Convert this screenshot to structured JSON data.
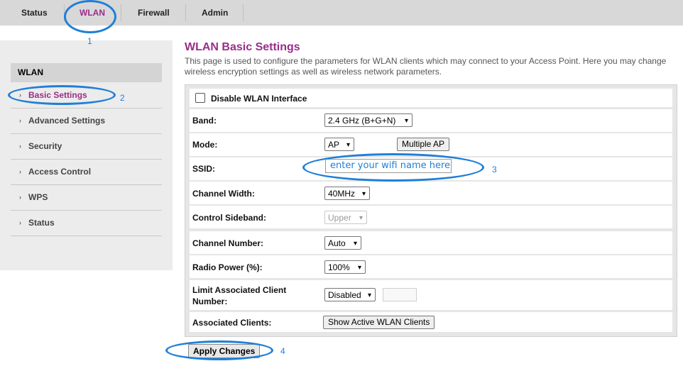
{
  "topnav": {
    "tabs": [
      {
        "label": "Status"
      },
      {
        "label": "WLAN"
      },
      {
        "label": "Firewall"
      },
      {
        "label": "Admin"
      }
    ]
  },
  "sidebar": {
    "heading": "WLAN",
    "items": [
      {
        "label": "Basic Settings"
      },
      {
        "label": "Advanced Settings"
      },
      {
        "label": "Security"
      },
      {
        "label": "Access Control"
      },
      {
        "label": "WPS"
      },
      {
        "label": "Status"
      }
    ]
  },
  "page": {
    "title": "WLAN Basic Settings",
    "description": "This page is used to configure the parameters for WLAN clients which may connect to your Access Point. Here you may change wireless encryption settings as well as wireless network parameters."
  },
  "form": {
    "disable_label": "Disable WLAN Interface",
    "band_label": "Band:",
    "band_value": "2.4 GHz (B+G+N)",
    "mode_label": "Mode:",
    "mode_value": "AP",
    "multiple_ap_label": "Multiple AP",
    "ssid_label": "SSID:",
    "ssid_value": "enter your wifi name here",
    "channel_width_label": "Channel Width:",
    "channel_width_value": "40MHz",
    "control_sideband_label": "Control Sideband:",
    "control_sideband_value": "Upper",
    "channel_number_label": "Channel Number:",
    "channel_number_value": "Auto",
    "radio_power_label": "Radio Power (%):",
    "radio_power_value": "100%",
    "limit_clients_label_1": "Limit Associated Client",
    "limit_clients_label_2": "Number:",
    "limit_clients_value": "Disabled",
    "assoc_clients_label": "Associated Clients:",
    "show_clients_label": "Show Active WLAN Clients",
    "apply_label": "Apply Changes"
  },
  "annotations": {
    "n1": "1",
    "n2": "2",
    "n3": "3",
    "n4": "4"
  },
  "colors": {
    "accent": "#9b2c8a",
    "annotation": "#1f7fd8"
  }
}
